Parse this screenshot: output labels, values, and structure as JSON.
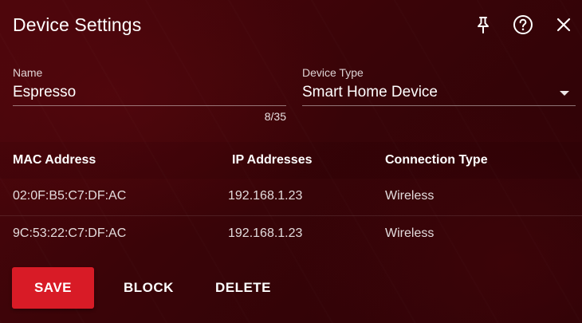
{
  "dialog": {
    "title": "Device Settings",
    "icons": {
      "pin": "pin-icon",
      "help": "help-icon",
      "close": "close-icon"
    }
  },
  "name_field": {
    "label": "Name",
    "value": "Espresso",
    "char_count": "8/35"
  },
  "device_type_field": {
    "label": "Device Type",
    "selected": "Smart Home Device"
  },
  "table": {
    "headers": [
      "MAC Address",
      "IP Addresses",
      "Connection Type"
    ],
    "rows": [
      [
        "02:0F:B5:C7:DF:AC",
        "192.168.1.23",
        "Wireless"
      ],
      [
        "9C:53:22:C7:DF:AC",
        "192.168.1.23",
        "Wireless"
      ]
    ]
  },
  "actions": {
    "save_label": "SAVE",
    "block_label": "BLOCK",
    "delete_label": "DELETE"
  },
  "colors": {
    "background": "#3a0408",
    "primary_button": "#d81b26",
    "text": "#ffffff"
  }
}
